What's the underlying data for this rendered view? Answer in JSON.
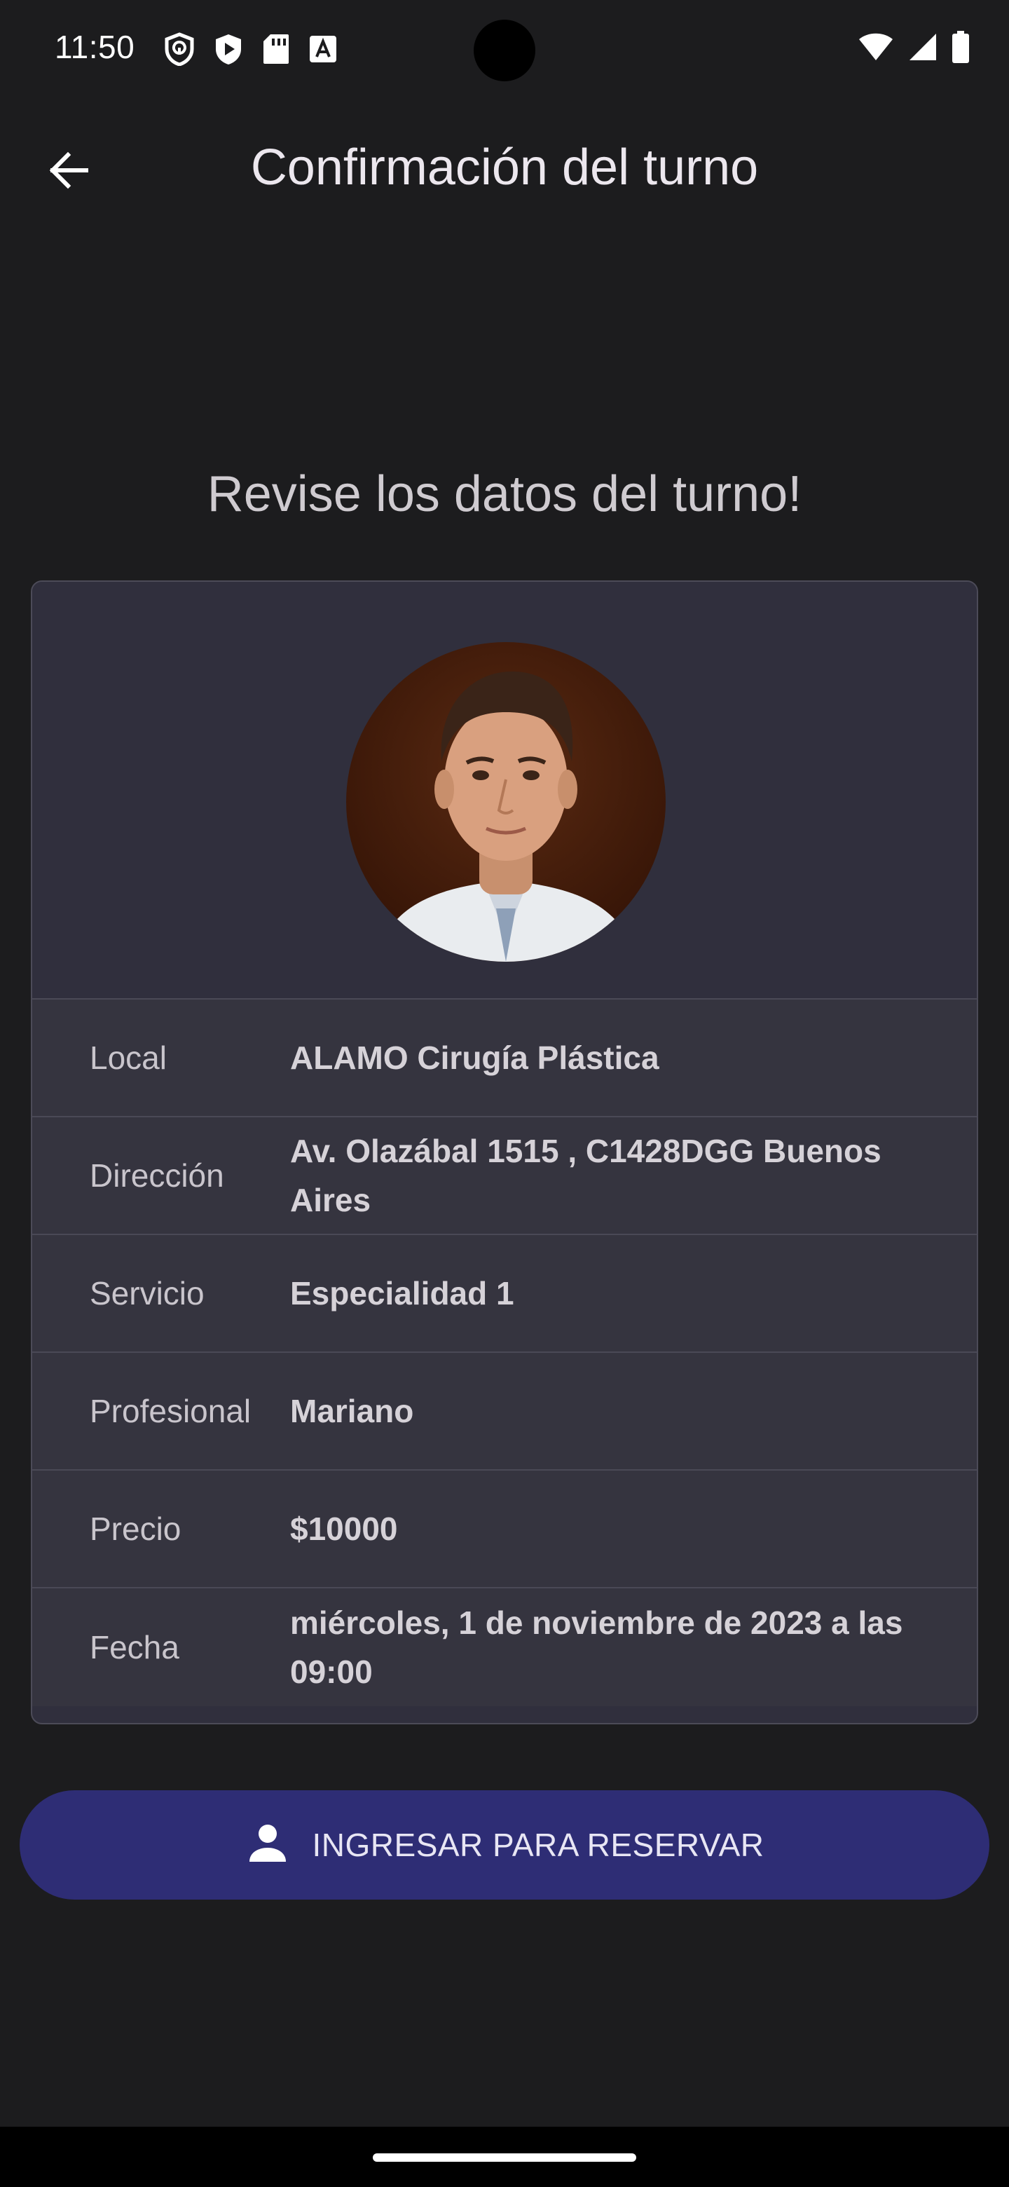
{
  "status_bar": {
    "time": "11:50",
    "left_icons": [
      "vpn-shield-icon",
      "play-protect-icon",
      "sd-card-icon",
      "font-a-icon"
    ],
    "right_icons": [
      "wifi-icon",
      "cellular-signal-icon",
      "battery-icon"
    ]
  },
  "app_bar": {
    "back_icon": "arrow-back-icon",
    "title": "Confirmación del turno"
  },
  "heading": "Revise los datos del turno!",
  "card": {
    "avatar_alt": "professional-photo",
    "rows": [
      {
        "label": "Local",
        "value": "ALAMO Cirugía Plástica"
      },
      {
        "label": "Dirección",
        "value": "Av. Olazábal 1515 , C1428DGG  Buenos Aires"
      },
      {
        "label": "Servicio",
        "value": "Especialidad 1"
      },
      {
        "label": "Profesional",
        "value": "Mariano"
      },
      {
        "label": "Precio",
        "value": "$10000"
      },
      {
        "label": "Fecha",
        "value": "miércoles, 1 de noviembre de 2023 a las 09:00"
      }
    ]
  },
  "cta": {
    "icon": "person-icon",
    "label": "INGRESAR PARA RESERVAR"
  },
  "colors": {
    "background": "#1c1c1e",
    "card": "#35343f",
    "button": "#2e2d75"
  }
}
